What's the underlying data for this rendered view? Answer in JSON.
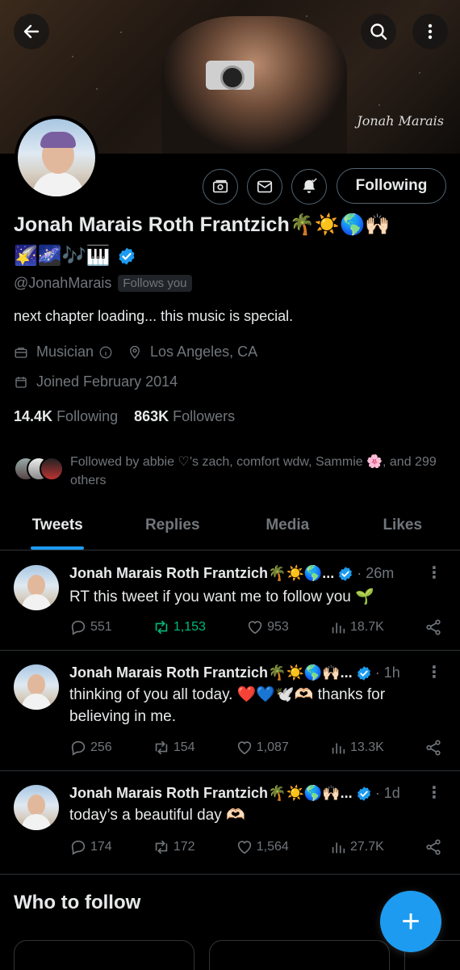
{
  "profile": {
    "name": "Jonah Marais Roth Frantzich🌴☀️🌎🙌🏻",
    "emoji_line": "🌠🌌🎶🎹",
    "handle": "@JonahMarais",
    "follows_you": "Follows you",
    "bio": "next chapter loading... this music is special.",
    "category": "Musician",
    "location": "Los Angeles, CA",
    "joined": "Joined February 2014",
    "following_count": "14.4K",
    "following_label": "Following",
    "followers_count": "863K",
    "followers_label": "Followers",
    "followed_by": "Followed by abbie ♡’s zach, comfort wdw, Sammie 🌸, and 299 others",
    "banner_signature": "Jonah Marais"
  },
  "header": {
    "back_icon": "back-arrow-icon",
    "search_icon": "search-icon",
    "more_icon": "more-vertical-icon"
  },
  "actions": {
    "following_button": "Following"
  },
  "tabs": [
    {
      "label": "Tweets",
      "active": true
    },
    {
      "label": "Replies",
      "active": false
    },
    {
      "label": "Media",
      "active": false
    },
    {
      "label": "Likes",
      "active": false
    }
  ],
  "tweets": [
    {
      "name": "Jonah Marais Roth Frantzich🌴☀️🌎...",
      "time": "· 26m",
      "text": "RT this tweet if you want me to follow you 🌱",
      "replies": "551",
      "retweets": "1,153",
      "likes": "953",
      "views": "18.7K"
    },
    {
      "name": "Jonah Marais Roth Frantzich🌴☀️🌎🙌🏻...",
      "time": "· 1h",
      "text": "thinking of you all today. ❤️💙🕊️🫶🏻 thanks for believing in me.",
      "replies": "256",
      "retweets": "154",
      "likes": "1,087",
      "views": "13.3K"
    },
    {
      "name": "Jonah Marais Roth Frantzich🌴☀️🌎🙌🏻...",
      "time": "· 1d",
      "text": "today’s a beautiful day 🫶🏻",
      "replies": "174",
      "retweets": "172",
      "likes": "1,564",
      "views": "27.7K"
    }
  ],
  "who_to_follow": "Who to follow",
  "fab_label": "+",
  "colors": {
    "accent": "#1d9bf0",
    "retweet_active": "#00ba7c",
    "muted": "#71767b"
  }
}
